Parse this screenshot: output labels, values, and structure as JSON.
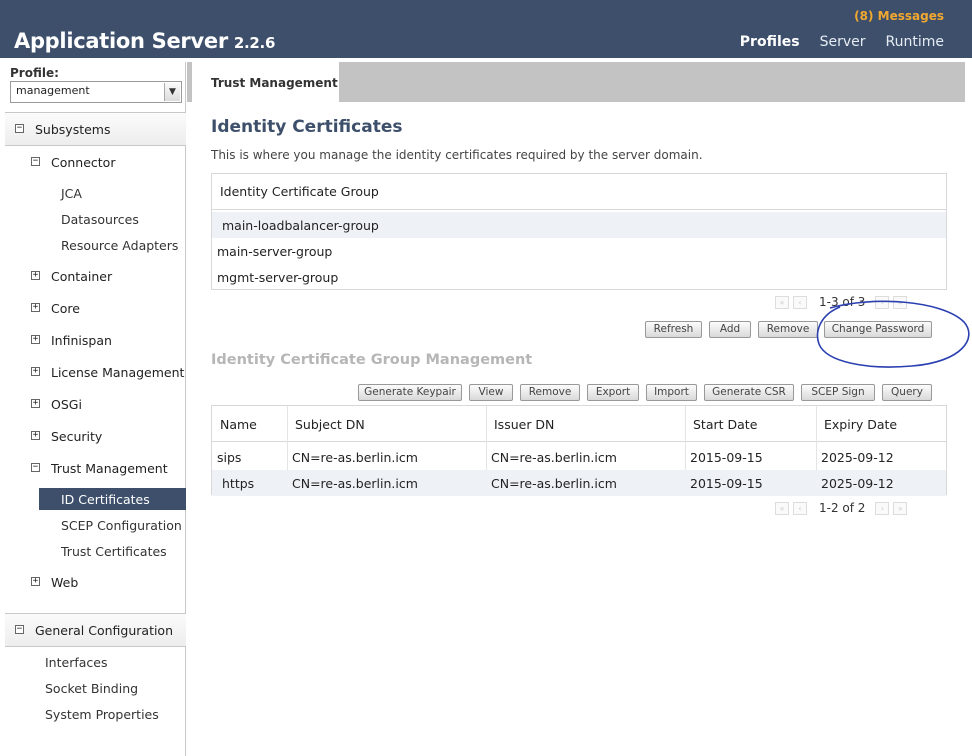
{
  "header": {
    "app_name": "Application Server",
    "version": "2.2.6",
    "messages": "(8) Messages",
    "nav": [
      "Profiles",
      "Server",
      "Runtime"
    ]
  },
  "sidebar": {
    "profile_label": "Profile:",
    "profile_value": "management",
    "subsystems_label": "Subsystems",
    "connector": {
      "label": "Connector",
      "children": [
        "JCA",
        "Datasources",
        "Resource Adapters"
      ]
    },
    "groups": [
      "Container",
      "Core",
      "Infinispan",
      "License Management",
      "OSGi",
      "Security"
    ],
    "trust": {
      "label": "Trust Management",
      "children": [
        "ID Certificates",
        "SCEP Configuration",
        "Trust Certificates"
      ],
      "selected": "ID Certificates"
    },
    "web": "Web",
    "general_label": "General Configuration",
    "general_items": [
      "Interfaces",
      "Socket Binding",
      "System Properties"
    ]
  },
  "main": {
    "tab": "Trust Management",
    "title": "Identity Certificates",
    "description": "This is where you manage the identity certificates required by the server domain.",
    "groups_table": {
      "header": "Identity Certificate Group",
      "rows": [
        "main-loadbalancer-group",
        "main-server-group",
        "mgmt-server-group"
      ],
      "pager": "1-3 of 3"
    },
    "group_buttons": [
      "Refresh",
      "Add",
      "Remove",
      "Change Password"
    ],
    "management_title": "Identity Certificate Group Management",
    "management_buttons": [
      "Generate Keypair",
      "View",
      "Remove",
      "Export",
      "Import",
      "Generate CSR",
      "SCEP Sign",
      "Query"
    ],
    "cert_table": {
      "columns": [
        "Name",
        "Subject DN",
        "Issuer DN",
        "Start Date",
        "Expiry Date"
      ],
      "rows": [
        [
          "sips",
          "CN=re-as.berlin.icm",
          "CN=re-as.berlin.icm",
          "2015-09-15",
          "2025-09-12"
        ],
        [
          "https",
          "CN=re-as.berlin.icm",
          "CN=re-as.berlin.icm",
          "2015-09-15",
          "2025-09-12"
        ]
      ],
      "pager": "1-2 of 2"
    }
  },
  "colors": {
    "header_bg": "#3d4f6b",
    "messages": "#f0a830",
    "annotation_circle": "#2a3fb0"
  }
}
